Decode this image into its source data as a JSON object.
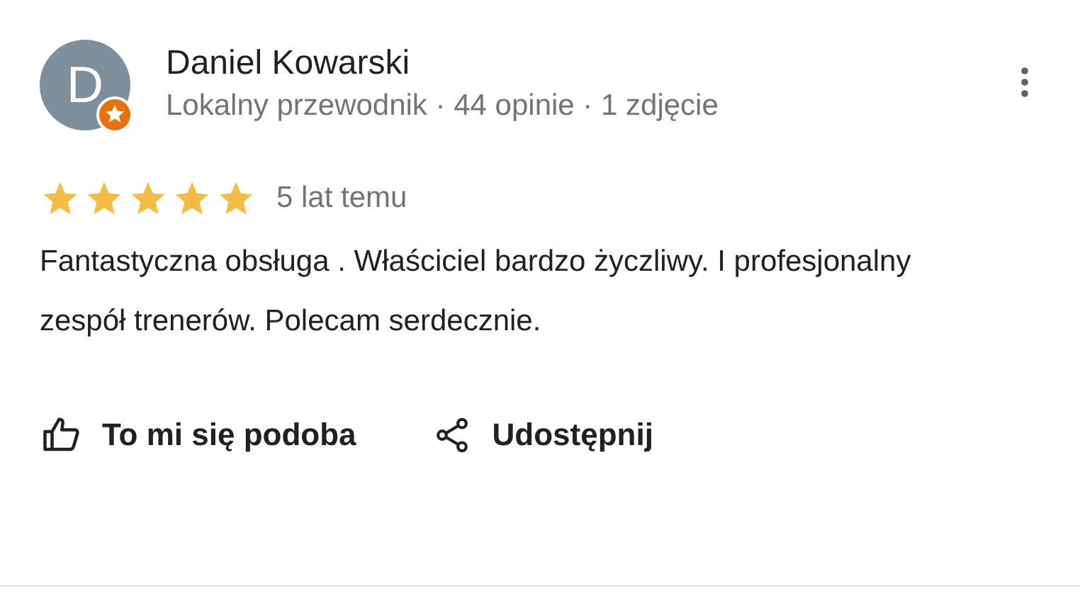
{
  "review": {
    "avatar_letter": "D",
    "local_guide": true,
    "author": "Daniel Kowarski",
    "meta": "Lokalny przewodnik · 44 opinie · 1 zdjęcie",
    "stars": 5,
    "time": "5 lat temu",
    "text": "Fantastyczna obsługa . Właściciel bardzo życzliwy. I profesjonalny zespół trenerów. Polecam serdecznie.",
    "actions": [
      {
        "kind": "like",
        "label": "To mi się podoba"
      },
      {
        "kind": "share",
        "label": "Udostępnij"
      }
    ]
  }
}
